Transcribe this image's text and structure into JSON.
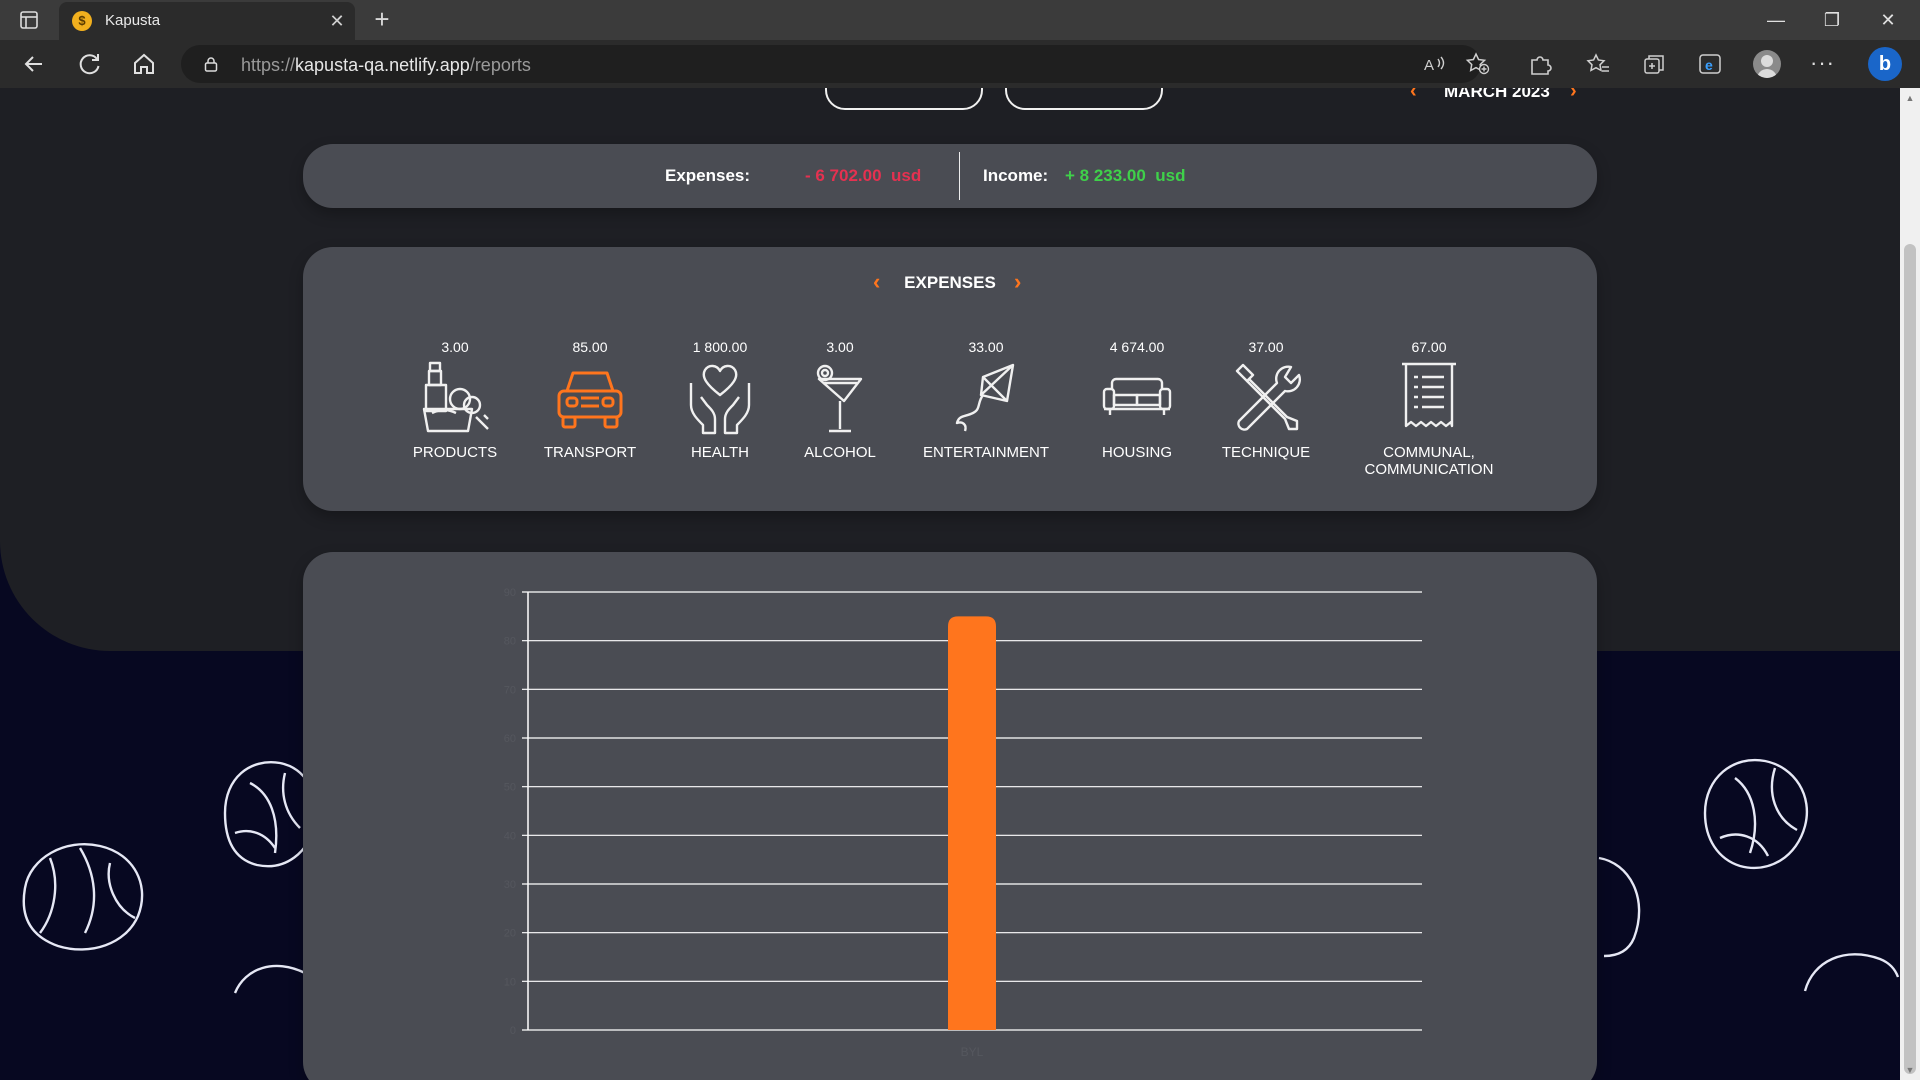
{
  "browser": {
    "tab_title": "Kapusta",
    "tab_favicon": "$",
    "url_scheme": "https://",
    "url_host": "kapusta-qa.netlify.app",
    "url_path": "/reports"
  },
  "report": {
    "period_label": "MARCH 2023",
    "summary": {
      "expenses_label": "Expenses:",
      "expenses_value": "- 6 702.00  usd",
      "income_label": "Income:",
      "income_value": "+ 8 233.00  usd",
      "expenses_color": "#e53150",
      "income_color": "#407946"
    },
    "category_mode": "EXPENSES",
    "categories": [
      {
        "label": "PRODUCTS",
        "amount": "3.00",
        "icon": "products-icon",
        "active": false
      },
      {
        "label": "TRANSPORT",
        "amount": "85.00",
        "icon": "car-icon",
        "active": true
      },
      {
        "label": "HEALTH",
        "amount": "1 800.00",
        "icon": "heart-hands-icon",
        "active": false
      },
      {
        "label": "ALCOHOL",
        "amount": "3.00",
        "icon": "cocktail-icon",
        "active": false
      },
      {
        "label": "ENTERTAINMENT",
        "amount": "33.00",
        "icon": "kite-icon",
        "active": false
      },
      {
        "label": "HOUSING",
        "amount": "4 674.00",
        "icon": "sofa-icon",
        "active": false
      },
      {
        "label": "TECHNIQUE",
        "amount": "37.00",
        "icon": "tools-icon",
        "active": false
      },
      {
        "label": "COMMUNAL, COMMUNICATION",
        "amount": "67.00",
        "icon": "receipt-icon",
        "active": false
      }
    ],
    "accent_color": "#ff751d"
  },
  "chart_data": {
    "type": "bar",
    "categories": [
      "BYL"
    ],
    "values": [
      85
    ],
    "ylim": [
      0,
      90
    ],
    "yticks": [
      0,
      10,
      20,
      30,
      40,
      50,
      60,
      70,
      80,
      90
    ],
    "grid": true,
    "bar_color": "#ff751d"
  }
}
